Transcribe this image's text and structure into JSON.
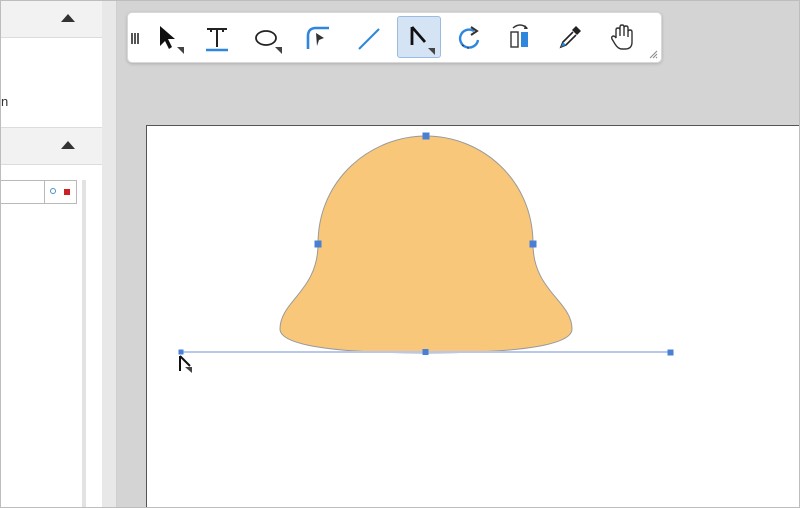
{
  "left_panel": {
    "text_fragment": "n"
  },
  "toolbar": {
    "tools": [
      {
        "name": "select",
        "active": false
      },
      {
        "name": "text",
        "active": false
      },
      {
        "name": "ellipse",
        "active": false
      },
      {
        "name": "curve",
        "active": false
      },
      {
        "name": "line",
        "active": false
      },
      {
        "name": "polyline",
        "active": true
      },
      {
        "name": "rotate",
        "active": false
      },
      {
        "name": "flip",
        "active": false
      },
      {
        "name": "eyedropper",
        "active": false
      },
      {
        "name": "pan",
        "active": false
      }
    ]
  },
  "colors": {
    "shape_fill": "#f8c77a",
    "shape_stroke": "#9a9a9a",
    "handle": "#4a7fd6",
    "accent_blue": "#2e86de",
    "active_tool_bg": "#d4e4f5"
  },
  "icons": {
    "panel_collapse": "triangle-up-icon",
    "field_option": "circle-icon",
    "field_color": "red-square-icon",
    "cursor": "polyline-cursor-icon"
  }
}
